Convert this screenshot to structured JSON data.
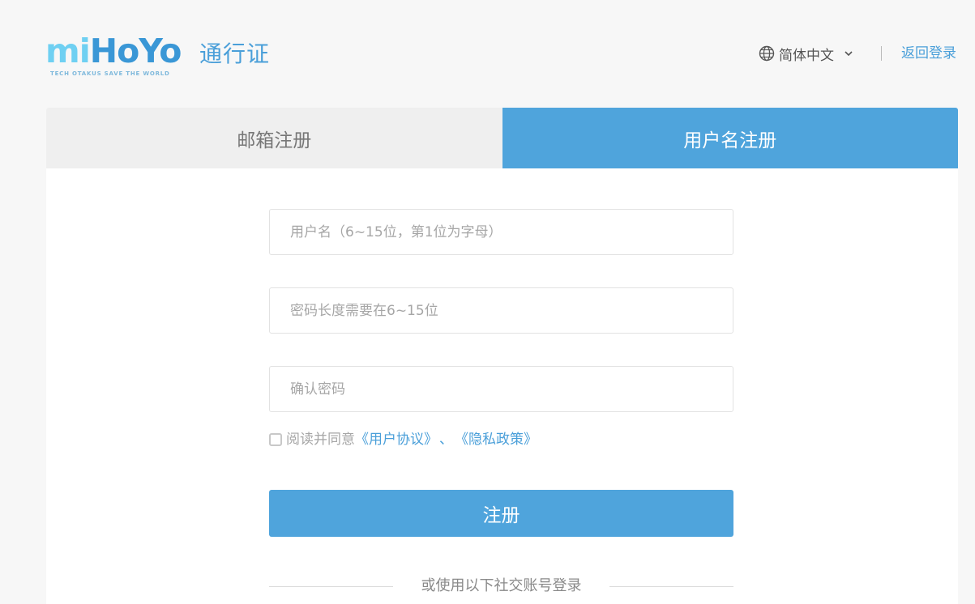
{
  "header": {
    "logo_text": "miHoYo",
    "logo_tagline": "TECH OTAKUS SAVE THE WORLD",
    "title": "通行证",
    "language": "简体中文",
    "back_login": "返回登录"
  },
  "tabs": [
    {
      "label": "邮箱注册",
      "active": false
    },
    {
      "label": "用户名注册",
      "active": true
    }
  ],
  "form": {
    "username_placeholder": "用户名（6~15位，第1位为字母）",
    "password_placeholder": "密码长度需要在6~15位",
    "confirm_placeholder": "确认密码",
    "agree_text": "阅读并同意",
    "user_agreement": "《用户协议》",
    "separator": "、",
    "privacy_policy": "《隐私政策》",
    "agreed": false,
    "submit_label": "注册"
  },
  "social": {
    "label": "或使用以下社交账号登录"
  },
  "icons": {
    "language": "globe-icon",
    "dropdown": "chevron-down-icon"
  },
  "colors": {
    "accent": "#4fa4dc",
    "link": "#4a9fd9",
    "inactive_tab": "#efefef"
  }
}
